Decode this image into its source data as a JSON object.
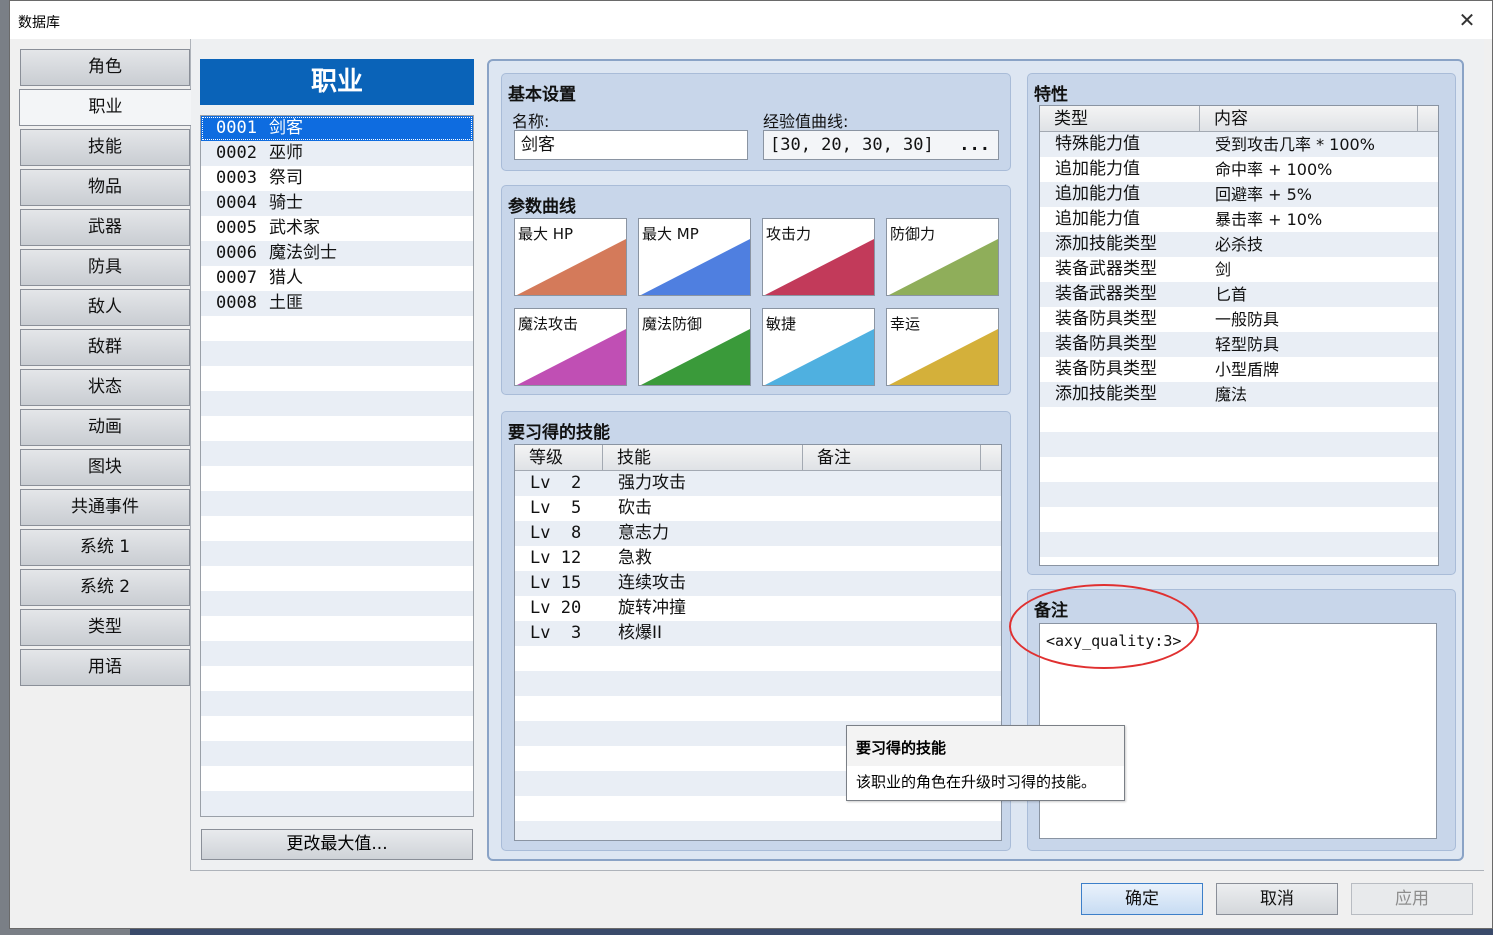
{
  "window": {
    "title": "数据库",
    "close_glyph": "✕"
  },
  "nav": {
    "items": [
      {
        "label": "角色"
      },
      {
        "label": "职业"
      },
      {
        "label": "技能"
      },
      {
        "label": "物品"
      },
      {
        "label": "武器"
      },
      {
        "label": "防具"
      },
      {
        "label": "敌人"
      },
      {
        "label": "敌群"
      },
      {
        "label": "状态"
      },
      {
        "label": "动画"
      },
      {
        "label": "图块"
      },
      {
        "label": "共通事件"
      },
      {
        "label": "系统 1"
      },
      {
        "label": "系统 2"
      },
      {
        "label": "类型"
      },
      {
        "label": "用语"
      }
    ],
    "active_index": 1
  },
  "class_list": {
    "header": "职业",
    "items": [
      {
        "id": "0001",
        "name": "剑客"
      },
      {
        "id": "0002",
        "name": "巫师"
      },
      {
        "id": "0003",
        "name": "祭司"
      },
      {
        "id": "0004",
        "name": "骑士"
      },
      {
        "id": "0005",
        "name": "武术家"
      },
      {
        "id": "0006",
        "name": "魔法剑士"
      },
      {
        "id": "0007",
        "name": "猎人"
      },
      {
        "id": "0008",
        "name": "土匪"
      }
    ],
    "selected_index": 0,
    "max_button": "更改最大值..."
  },
  "basic": {
    "title": "基本设置",
    "name_label": "名称:",
    "name_value": "剑客",
    "exp_label": "经验值曲线:",
    "exp_value": "[30, 20, 30, 30]",
    "exp_button": "..."
  },
  "params": {
    "title": "参数曲线",
    "curves": [
      {
        "label": "最大 HP",
        "color": "#d47a5a"
      },
      {
        "label": "最大 MP",
        "color": "#4f7fe0"
      },
      {
        "label": "攻击力",
        "color": "#c23a5a"
      },
      {
        "label": "防御力",
        "color": "#8fae5a"
      },
      {
        "label": "魔法攻击",
        "color": "#c04fb4"
      },
      {
        "label": "魔法防御",
        "color": "#3a9a3a"
      },
      {
        "label": "敏捷",
        "color": "#4fb0e0"
      },
      {
        "label": "幸运",
        "color": "#d4b03a"
      }
    ]
  },
  "skills": {
    "title": "要习得的技能",
    "columns": [
      "等级",
      "技能",
      "备注"
    ],
    "rows": [
      {
        "level": "Lv  2",
        "skill": "强力攻击",
        "note": ""
      },
      {
        "level": "Lv  5",
        "skill": "砍击",
        "note": ""
      },
      {
        "level": "Lv  8",
        "skill": "意志力",
        "note": ""
      },
      {
        "level": "Lv 12",
        "skill": "急救",
        "note": ""
      },
      {
        "level": "Lv 15",
        "skill": "连续攻击",
        "note": ""
      },
      {
        "level": "Lv 20",
        "skill": "旋转冲撞",
        "note": ""
      },
      {
        "level": "Lv  3",
        "skill": "核爆II",
        "note": ""
      }
    ]
  },
  "traits": {
    "title": "特性",
    "columns": [
      "类型",
      "内容"
    ],
    "rows": [
      {
        "type": "特殊能力值",
        "content": "受到攻击几率 * 100%"
      },
      {
        "type": "追加能力值",
        "content": "命中率 + 100%"
      },
      {
        "type": "追加能力值",
        "content": "回避率 + 5%"
      },
      {
        "type": "追加能力值",
        "content": "暴击率 + 10%"
      },
      {
        "type": "添加技能类型",
        "content": "必杀技"
      },
      {
        "type": "装备武器类型",
        "content": "剑"
      },
      {
        "type": "装备武器类型",
        "content": "匕首"
      },
      {
        "type": "装备防具类型",
        "content": "一般防具"
      },
      {
        "type": "装备防具类型",
        "content": "轻型防具"
      },
      {
        "type": "装备防具类型",
        "content": "小型盾牌"
      },
      {
        "type": "添加技能类型",
        "content": "魔法"
      }
    ]
  },
  "note": {
    "title": "备注",
    "value": "<axy_quality:3>"
  },
  "tooltip": {
    "title": "要习得的技能",
    "body": "该职业的角色在升级时习得的技能。"
  },
  "footer": {
    "ok": "确定",
    "cancel": "取消",
    "apply": "应用"
  }
}
